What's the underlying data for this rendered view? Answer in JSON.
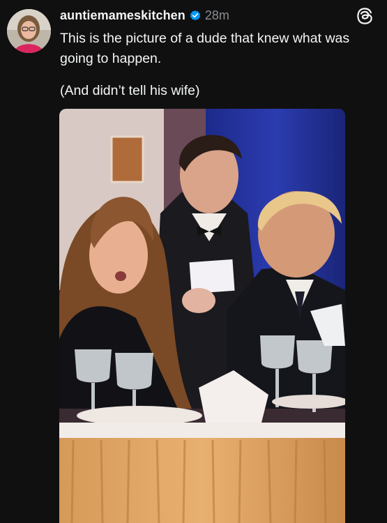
{
  "post": {
    "username": "auntiemameskitchen",
    "timestamp": "28m",
    "caption_line1": "This is the picture of a dude that knew what was going to happen.",
    "caption_line2": "(And didn’t tell his wife)"
  },
  "icons": {
    "verified": "verified-badge-icon",
    "app": "threads-logo-icon"
  },
  "colors": {
    "background": "#101010",
    "text": "#f3f5f7",
    "secondary_text": "#8a8d91",
    "verified_blue": "#0095f6"
  }
}
